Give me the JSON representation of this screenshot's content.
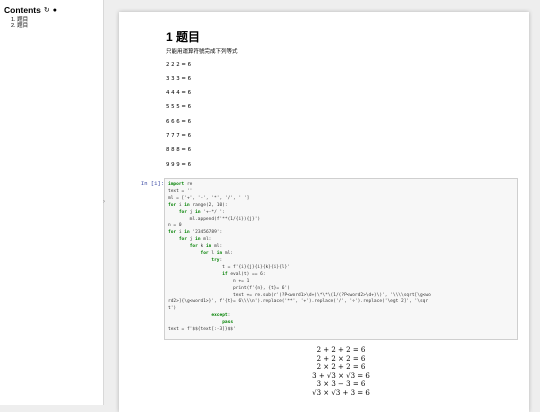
{
  "toc": {
    "title": "Contents",
    "items": [
      "1. 题目",
      "2. 题目"
    ]
  },
  "notebook": {
    "heading": "1  题目",
    "intro": "只能用運算符號完成下列等式",
    "equations": [
      "2 2 2 = 6",
      "3 3 3 = 6",
      "4 4 4 = 6",
      "5 5 5 = 6",
      "6 6 6 = 6",
      "7 7 7 = 6",
      "8 8 8 = 6",
      "9 9 9 = 6"
    ],
    "cell_prompt": "In [1]:",
    "code_lines": [
      "import re",
      "text = ''",
      "ml = ['+', '-', '*', '/', ' ']",
      "for i in range(2, 10):",
      "    for j in '+-*/ ':",
      "        ml.append(f'**(1/{i}){j}')",
      "n = 0",
      "for i in '23456789':",
      "    for j in ml:",
      "        for k in ml:",
      "            for l in ml:",
      "                try:",
      "                    t = f'{i}{j}{i}{k}{i}{l}'",
      "                    if eval(t) == 6:",
      "                        n += 1",
      "                        print(f'{n}, {t}= 6')",
      "                        text += re.sub(r'(?P<word1>\\d+)\\*\\*\\(1/(?P<word2>\\d+)\\)', '\\\\\\\\sqrt[\\g<wo",
      "rd2>]{\\g<word1>}', f'{t}= 6\\\\\\\\n').replace('**', '+').replace('/', '÷').replace('\\egt 2]', '\\sqr",
      "t')",
      "                except:",
      "                    pass",
      "text = f'$${text[:-3]}$$'"
    ],
    "output_lines": [
      "2 + 2 + 2 = 6",
      "2 + 2 × 2 = 6",
      "2 × 2 + 2 = 6",
      "3 + √3 × √3 = 6",
      "3 × 3 − 3 = 6",
      "√3 × √3 + 3 = 6"
    ]
  }
}
